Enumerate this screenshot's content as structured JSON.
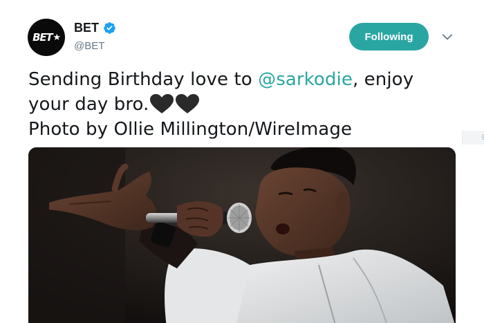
{
  "tweet": {
    "author": {
      "logo_text": "BET",
      "name": "BET",
      "handle": "@BET",
      "verified": true
    },
    "follow_label": "Following",
    "text_before": "Sending Birthday love to ",
    "mention": "@sarkodie",
    "text_after": ", enjoy your day bro.",
    "credit": "Photo by Ollie Millington/WireImage",
    "emoji": [
      "black-heart-icon",
      "black-heart-icon"
    ]
  },
  "side_tab": {
    "label": "E"
  },
  "colors": {
    "accent": "#2aa6a2",
    "verified": "#1da1f2",
    "text": "#14171a",
    "secondary": "#657786"
  }
}
